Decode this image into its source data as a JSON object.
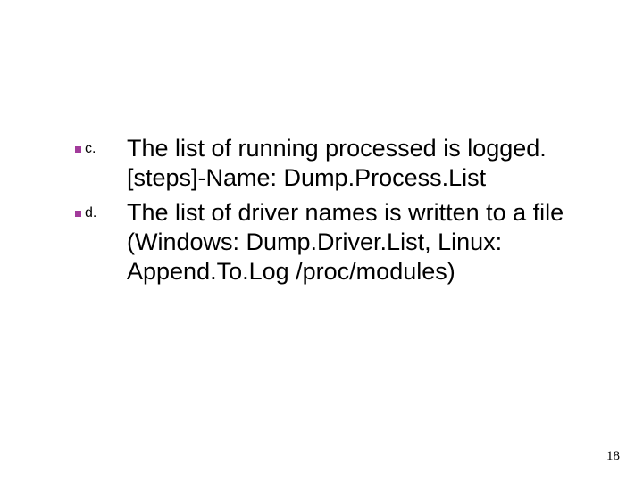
{
  "items": [
    {
      "marker": "c.",
      "text": "The list of running processed is logged. [steps]-Name: Dump.Process.List"
    },
    {
      "marker": "d.",
      "text": "The list of driver names is written to a file (Windows: Dump.Driver.List, Linux: Append.To.Log /proc/modules)"
    }
  ],
  "page_number": "18"
}
